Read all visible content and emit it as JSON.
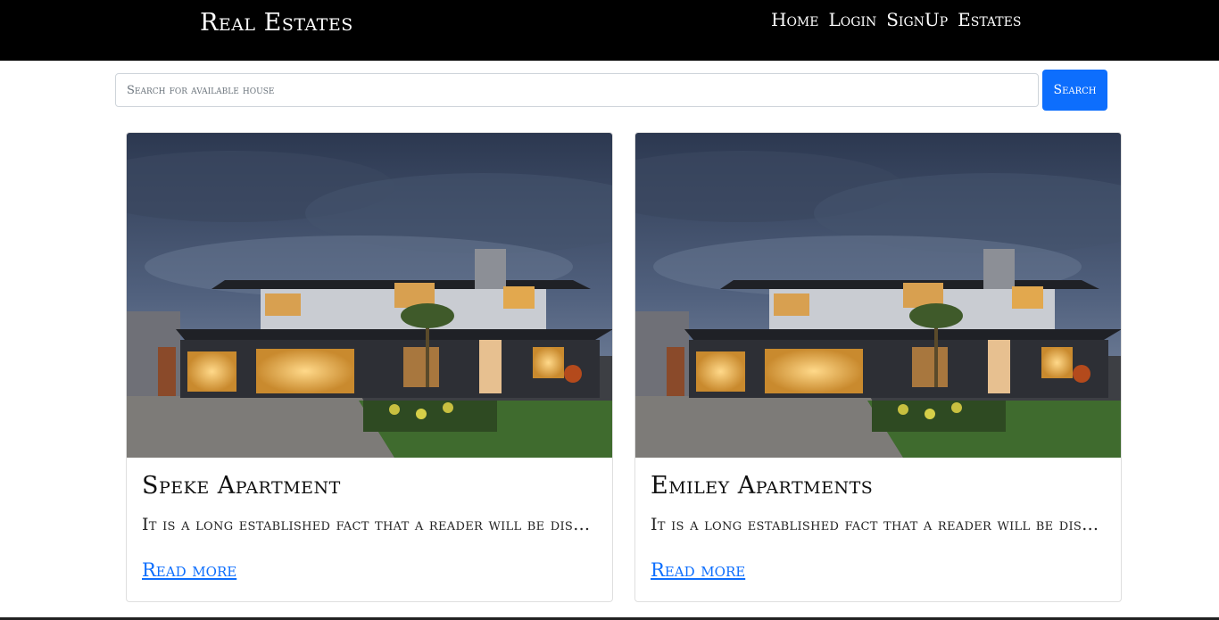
{
  "header": {
    "brand": "Real Estates",
    "nav": [
      {
        "label": "Home"
      },
      {
        "label": "Login"
      },
      {
        "label": "SignUp"
      },
      {
        "label": "Estates"
      }
    ]
  },
  "search": {
    "placeholder": "Search for available house",
    "value": "",
    "button_label": "Search"
  },
  "cards": [
    {
      "title": "Speke Apartment",
      "text": "It is a long established fact that a reader will be distracted by the readable content of a page when looking at its layout.",
      "link": "Read more"
    },
    {
      "title": "Emiley Apartments",
      "text": "It is a long established fact that a reader will be distracted by the readable content of a page when looking at its layout.",
      "link": "Read more"
    }
  ],
  "colors": {
    "navbar": "#000000",
    "accent": "#0d6efd"
  }
}
